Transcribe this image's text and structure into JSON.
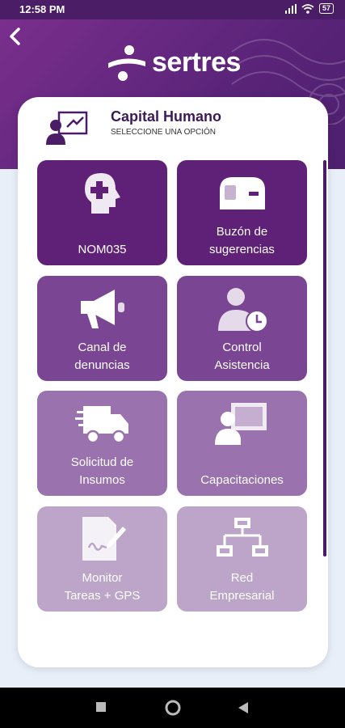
{
  "status_bar": {
    "time": "12:58 PM",
    "battery": "57"
  },
  "header": {
    "brand": "sertres",
    "back_icon": "chevron-left-icon"
  },
  "card": {
    "title": "Capital Humano",
    "subtitle": "SELECCIONE UNA OPCIÓN"
  },
  "tiles": [
    {
      "label": "NOM035",
      "icon": "brain-plus-icon",
      "color": "#5e2177"
    },
    {
      "label": "Buzón de\nsugerencias",
      "icon": "mailbox-icon",
      "color": "#5e2177"
    },
    {
      "label": "Canal de\ndenuncias",
      "icon": "megaphone-icon",
      "color": "#7a4593"
    },
    {
      "label": "Control\nAsistencia",
      "icon": "user-clock-icon",
      "color": "#7a4593"
    },
    {
      "label": "Solicitud de\nInsumos",
      "icon": "delivery-truck-icon",
      "color": "#9a72ae"
    },
    {
      "label": "Capacitaciones",
      "icon": "presentation-icon",
      "color": "#9a72ae"
    },
    {
      "label": "Monitor\nTareas + GPS",
      "icon": "signed-document-icon",
      "color": "#bca5c9"
    },
    {
      "label": "Red\nEmpresarial",
      "icon": "network-icon",
      "color": "#bca5c9"
    }
  ]
}
